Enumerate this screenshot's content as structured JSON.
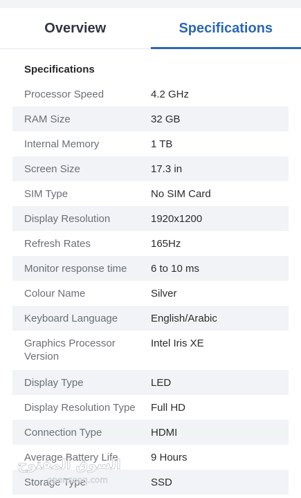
{
  "tabs": [
    {
      "label": "Overview",
      "active": false
    },
    {
      "label": "Specifications",
      "active": true
    }
  ],
  "section_title": "Specifications",
  "specs": [
    {
      "label": "Processor Speed",
      "value": "4.2 GHz"
    },
    {
      "label": "RAM Size",
      "value": "32 GB"
    },
    {
      "label": "Internal Memory",
      "value": "1 TB"
    },
    {
      "label": "Screen Size",
      "value": "17.3 in"
    },
    {
      "label": "SIM Type",
      "value": "No SIM Card"
    },
    {
      "label": "Display Resolution",
      "value": "1920x1200"
    },
    {
      "label": "Refresh Rates",
      "value": "165Hz"
    },
    {
      "label": "Monitor response time",
      "value": "6 to 10 ms"
    },
    {
      "label": "Colour Name",
      "value": "Silver"
    },
    {
      "label": "Keyboard Language",
      "value": "English/Arabic"
    },
    {
      "label": "Graphics Processor Version",
      "value": "Intel Iris XE"
    },
    {
      "label": "Display Type",
      "value": "LED"
    },
    {
      "label": "Display Resolution Type",
      "value": "Full HD"
    },
    {
      "label": "Connection Type",
      "value": "HDMI"
    },
    {
      "label": "Average Battery Life",
      "value": "9 Hours"
    },
    {
      "label": "Storage Type",
      "value": "SSD"
    }
  ],
  "watermark": {
    "arabic": "السوق المفتوح",
    "latin": "opensooq.com"
  },
  "colors": {
    "accent": "#2b67b5",
    "row_alt": "#f1f3f6"
  }
}
